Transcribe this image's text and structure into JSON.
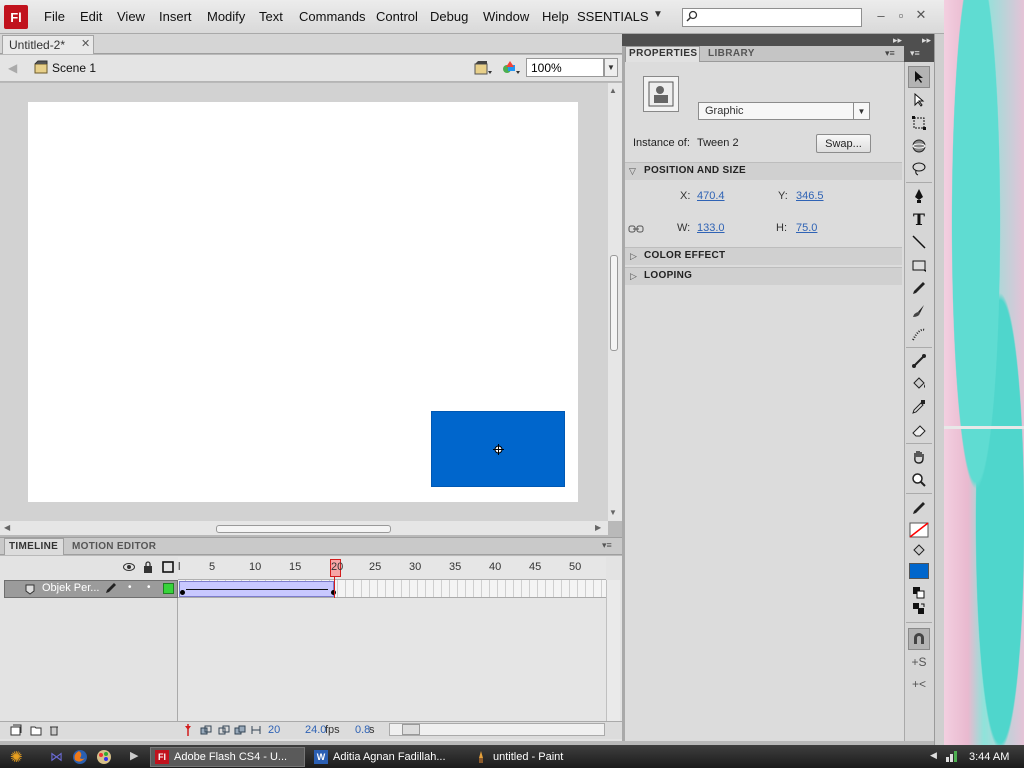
{
  "menubar": {
    "app_logo": "Fl",
    "items": [
      "File",
      "Edit",
      "View",
      "Insert",
      "Modify",
      "Text",
      "Commands",
      "Control",
      "Debug",
      "Window",
      "Help"
    ],
    "workspace": "SSENTIALS",
    "search_placeholder": "",
    "window_buttons": [
      "minimize-icon",
      "maximize-icon",
      "close-icon"
    ]
  },
  "document": {
    "tab_title": "Untitled-2*",
    "scene": "Scene 1",
    "zoom": "100%"
  },
  "stage": {
    "background": "#ffffff",
    "symbol_color": "#0066cc"
  },
  "timeline": {
    "tabs": [
      "TIMELINE",
      "MOTION EDITOR"
    ],
    "ruler": [
      "l",
      "5",
      "10",
      "15",
      "20",
      "25",
      "30",
      "35",
      "40",
      "45",
      "50"
    ],
    "playhead_frame": "20",
    "layer_name": "Objek Per...",
    "layer_color": "#37d43a",
    "tween_color": "#c8c8ff",
    "footer": {
      "current_frame": "20",
      "fps_value": "24.0",
      "fps_unit": "fps",
      "time_value": "0.8",
      "time_unit": "s"
    }
  },
  "properties": {
    "tabs": [
      "PROPERTIES",
      "LIBRARY"
    ],
    "symbol_type": "Graphic",
    "instance_label": "Instance of:",
    "instance_value": "Tween 2",
    "swap_button": "Swap...",
    "sections": {
      "position_and_size": "POSITION AND SIZE",
      "color_effect": "COLOR EFFECT",
      "looping": "LOOPING"
    },
    "x_label": "X:",
    "x_value": "470.4",
    "y_label": "Y:",
    "y_value": "346.5",
    "w_label": "W:",
    "w_value": "133.0",
    "h_label": "H:",
    "h_value": "75.0"
  },
  "tools": {
    "items": [
      "selection-tool-icon",
      "subselection-tool-icon",
      "free-transform-tool-icon",
      "3d-rotation-tool-icon",
      "lasso-tool-icon",
      "pen-tool-icon",
      "text-tool-icon",
      "line-tool-icon",
      "rectangle-tool-icon",
      "pencil-tool-icon",
      "brush-tool-icon",
      "deco-tool-icon",
      "bone-tool-icon",
      "paint-bucket-tool-icon",
      "eyedropper-tool-icon",
      "eraser-tool-icon",
      "hand-tool-icon",
      "zoom-tool-icon",
      "stroke-color-icon",
      "fill-color-icon",
      "black-white-icon",
      "swap-colors-icon",
      "snap-to-objects-icon",
      "smooth-icon",
      "straighten-icon"
    ],
    "stroke_color": "#ff0000",
    "fill_color": "#0066cc"
  },
  "taskbar": {
    "buttons": [
      "Adobe Flash CS4 - U...",
      "Aditia Agnan Fadillah...",
      "untitled - Paint"
    ],
    "clock": "3:44 AM"
  }
}
